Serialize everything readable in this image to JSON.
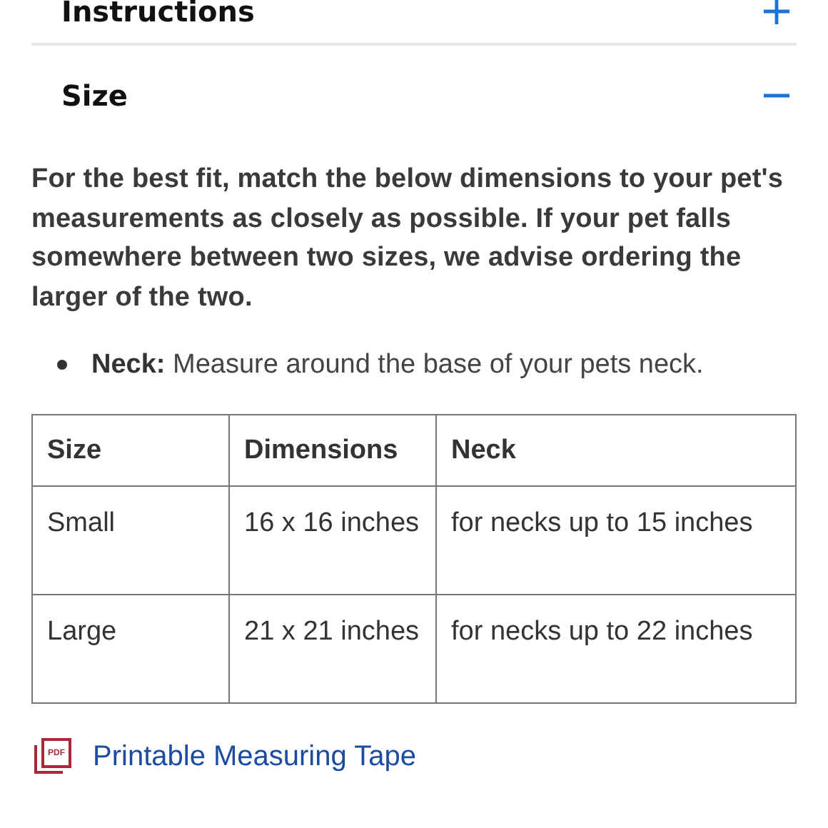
{
  "sections": [
    {
      "title": "Instructions",
      "expanded": false
    },
    {
      "title": "Size",
      "expanded": true,
      "intro": "For the best fit, match the below dimensions to your pet's measurements as closely as possible. If your pet falls somewhere between two sizes, we advise ordering the larger of the two.",
      "bullets": [
        "**Neck:** Measure around the base of your pets neck."
      ],
      "table": {
        "columns": [
          "Size",
          "Dimensions",
          "Neck"
        ],
        "rows": [
          [
            "Small",
            "16 x 16 inches",
            "for necks up to 15 inches"
          ],
          [
            "Large",
            "21 x 21 inches",
            "for necks up to 22 inches"
          ]
        ]
      },
      "link": {
        "icon_label": "PDF",
        "text": "Printable Measuring Tape"
      }
    }
  ]
}
